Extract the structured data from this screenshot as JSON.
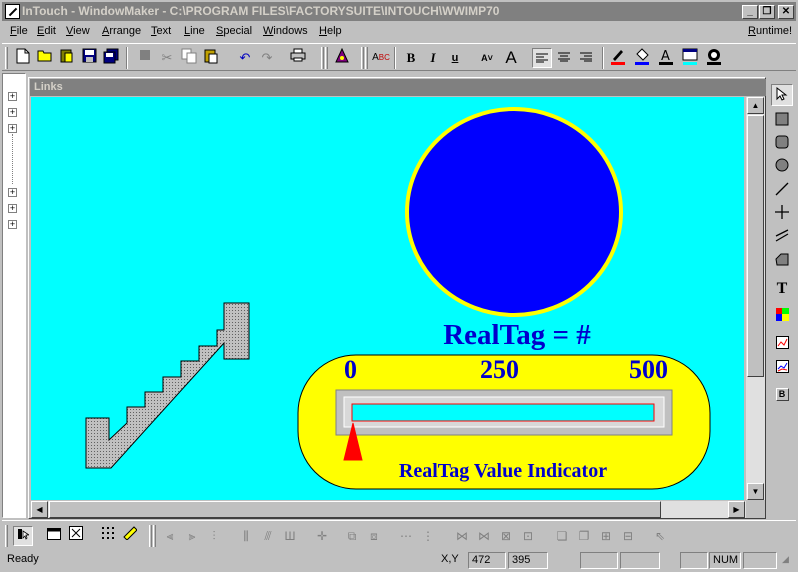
{
  "window": {
    "title": "InTouch - WindowMaker - C:\\PROGRAM FILES\\FACTORYSUITE\\INTOUCH\\WWIMP70",
    "minimize": "_",
    "restore": "❐",
    "close": "✕"
  },
  "menu": {
    "items": [
      "File",
      "Edit",
      "View",
      "Arrange",
      "Text",
      "Line",
      "Special",
      "Windows",
      "Help"
    ],
    "runtime": "Runtime!"
  },
  "child_window": {
    "title": "Links"
  },
  "canvas": {
    "realtag_label": "RealTag = #",
    "scale": [
      "0",
      "250",
      "500"
    ],
    "indicator_caption": "RealTag Value Indicator",
    "colors": {
      "background": "#00ffff",
      "circle_fill": "#0000ff",
      "circle_border": "#ffff00",
      "panel_fill": "#ffff00",
      "text": "#0000cc",
      "pointer": "#ff0000"
    }
  },
  "statusbar": {
    "status": "Ready",
    "xy_label": "X,Y",
    "x": "472",
    "y": "395",
    "num": "NUM"
  }
}
